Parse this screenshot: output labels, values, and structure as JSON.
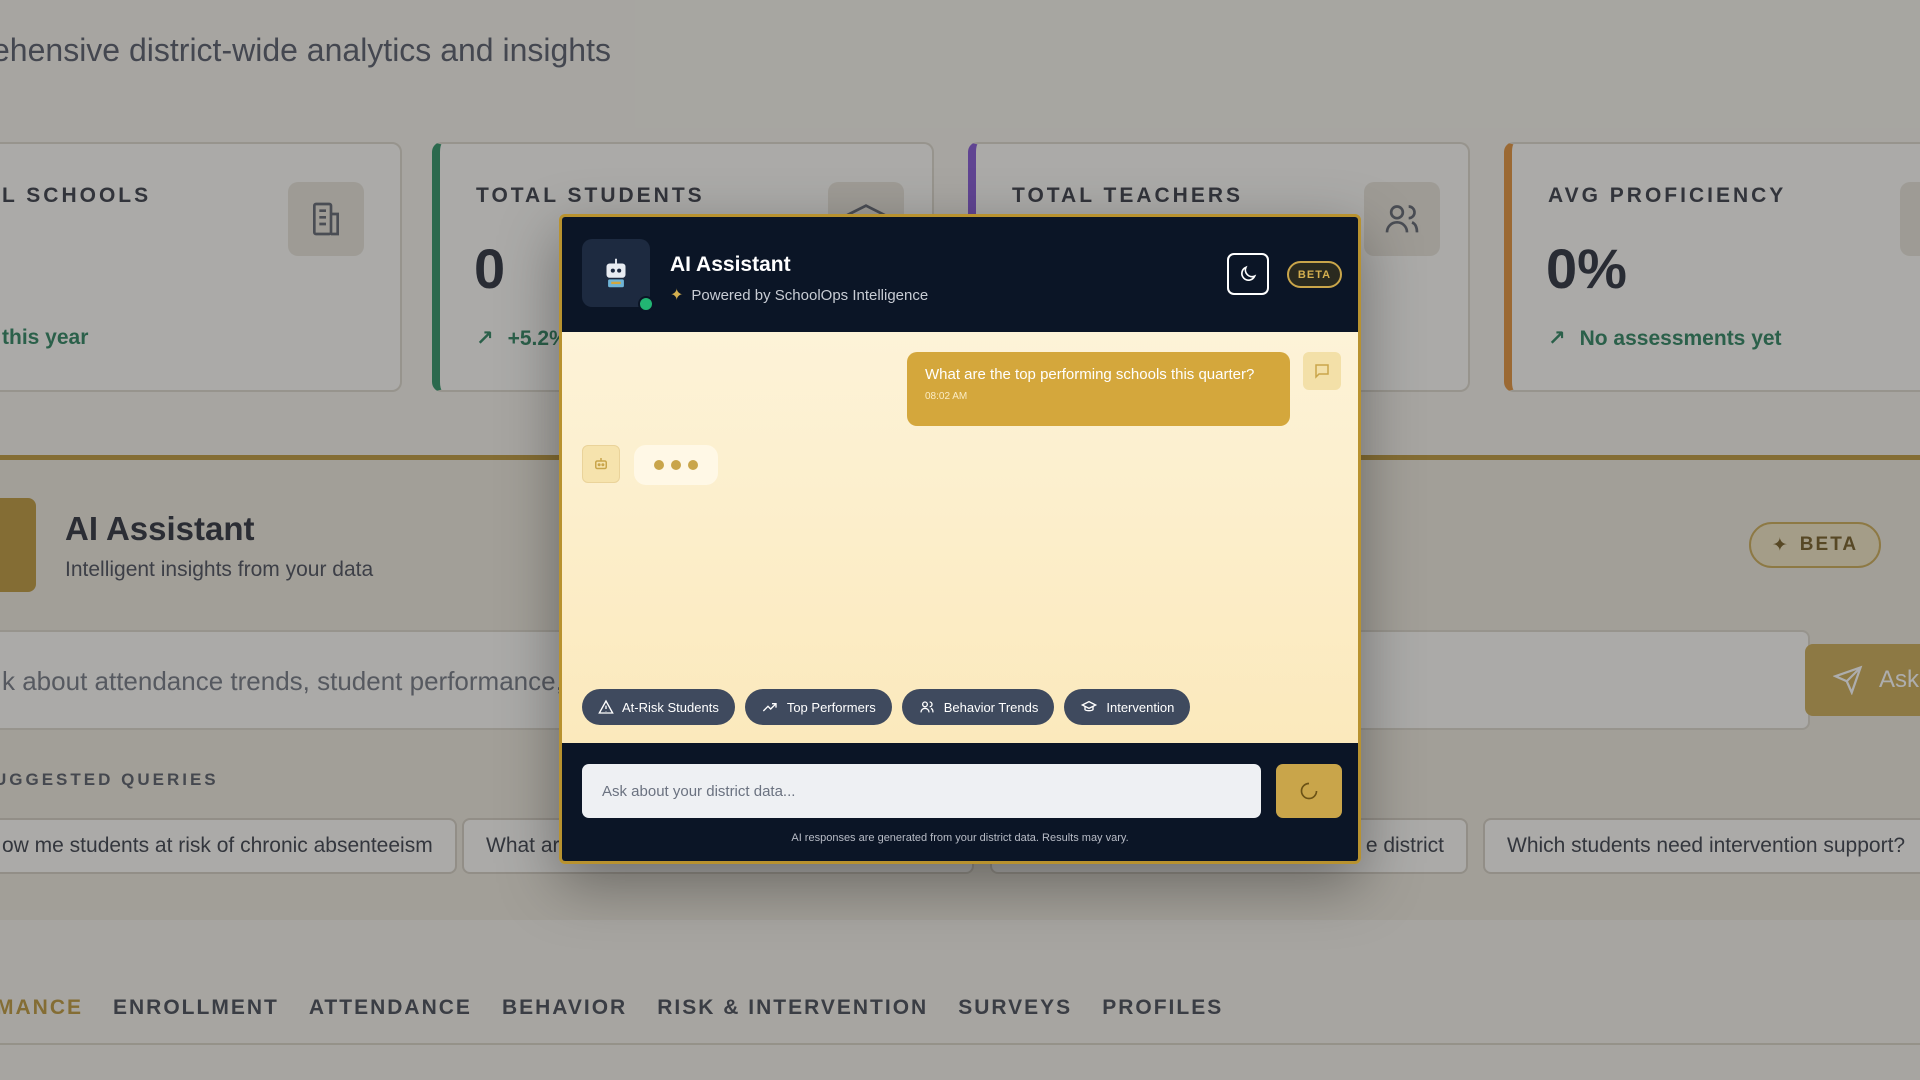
{
  "dashboard": {
    "subtitle": "ehensive district-wide analytics and insights",
    "stats": [
      {
        "label": "L SCHOOLS",
        "value": "",
        "trend": "this year",
        "icon": "building-icon"
      },
      {
        "label": "TOTAL STUDENTS",
        "value": "0",
        "trend": "+5.2%",
        "icon": "graduation-cap-icon"
      },
      {
        "label": "TOTAL TEACHERS",
        "value": "",
        "trend": "",
        "icon": "users-icon"
      },
      {
        "label": "AVG PROFICIENCY",
        "value": "0%",
        "trend": "No assessments yet",
        "icon": "chevron-icon"
      }
    ],
    "ai_panel": {
      "title": "AI Assistant",
      "subtitle": "Intelligent insights from your data",
      "beta": "BETA",
      "ask_placeholder": "k about attendance trends, student performance, ri",
      "ask_button": "Ask"
    },
    "suggested": {
      "label": "UGGESTED QUERIES",
      "queries": [
        "ow me students at risk of chronic absenteeism",
        "What ar",
        "e district",
        "Which students need intervention support?"
      ]
    },
    "tabs": [
      "MANCE",
      "ENROLLMENT",
      "ATTENDANCE",
      "BEHAVIOR",
      "RISK & INTERVENTION",
      "SURVEYS",
      "PROFILES"
    ]
  },
  "modal": {
    "title": "AI Assistant",
    "subtitle": "Powered by SchoolOps Intelligence",
    "beta": "BETA",
    "messages": [
      {
        "role": "user",
        "text": "What are the top performing schools this quarter?",
        "time": "08:02 AM"
      }
    ],
    "chips": [
      {
        "label": "At-Risk Students",
        "icon": "warning-triangle-icon"
      },
      {
        "label": "Top Performers",
        "icon": "trending-up-icon"
      },
      {
        "label": "Behavior Trends",
        "icon": "users-icon"
      },
      {
        "label": "Intervention",
        "icon": "graduation-cap-icon"
      }
    ],
    "input_placeholder": "Ask about your district data...",
    "disclaimer": "AI responses are generated from your district data. Results may vary."
  },
  "colors": {
    "navy": "#0b1526",
    "gold": "#c9a54a",
    "green": "#1f8a5a",
    "purple": "#7b4ad0",
    "orange": "#e08a2e"
  }
}
